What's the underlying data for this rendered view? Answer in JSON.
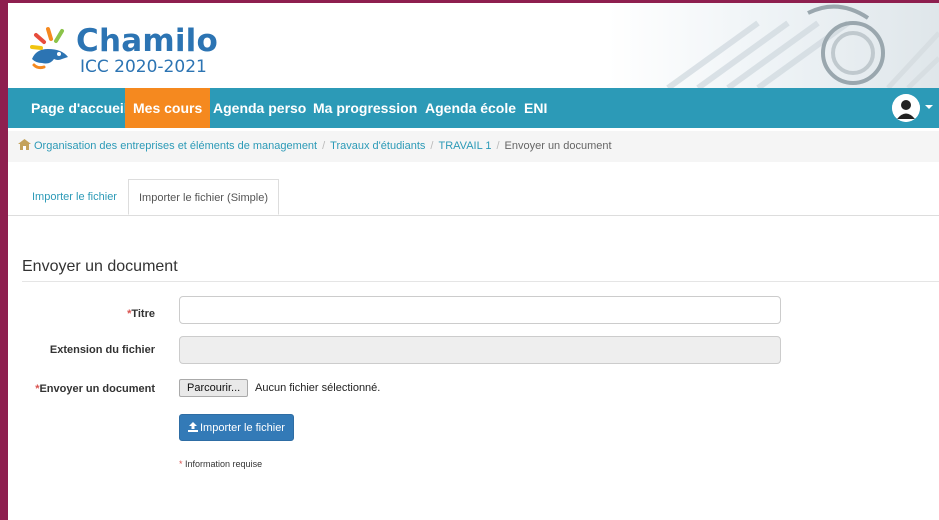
{
  "brand": {
    "name": "Chamilo",
    "subtitle": "ICC 2020-2021"
  },
  "nav": {
    "items": [
      {
        "label": "Page d'accueil"
      },
      {
        "label": "Mes cours"
      },
      {
        "label": "Agenda perso"
      },
      {
        "label": "Ma progression"
      },
      {
        "label": "Agenda école"
      },
      {
        "label": "ENI"
      }
    ],
    "active_index": 1
  },
  "breadcrumb": {
    "items": [
      {
        "label": "Organisation des entreprises et éléments de management"
      },
      {
        "label": "Travaux d'étudiants"
      },
      {
        "label": "TRAVAIL 1"
      }
    ],
    "current": "Envoyer un document",
    "separator": "/"
  },
  "tabs": [
    {
      "label": "Importer le fichier"
    },
    {
      "label": "Importer le fichier (Simple)"
    }
  ],
  "form": {
    "title": "Envoyer un document",
    "required_mark": "*",
    "fields": {
      "titre": {
        "label": "Titre",
        "value": ""
      },
      "extension": {
        "label": "Extension du fichier",
        "value": ""
      },
      "document": {
        "label": "Envoyer un document",
        "button": "Parcourir...",
        "status": "Aucun fichier sélectionné."
      }
    },
    "submit_label": "Importer le fichier",
    "required_note": "Information requise"
  },
  "colors": {
    "navbar": "#2c9ab7",
    "active_nav": "#f5891f",
    "primary_button": "#337ab7",
    "frame": "#8e1f4f",
    "required": "#d9534f"
  }
}
